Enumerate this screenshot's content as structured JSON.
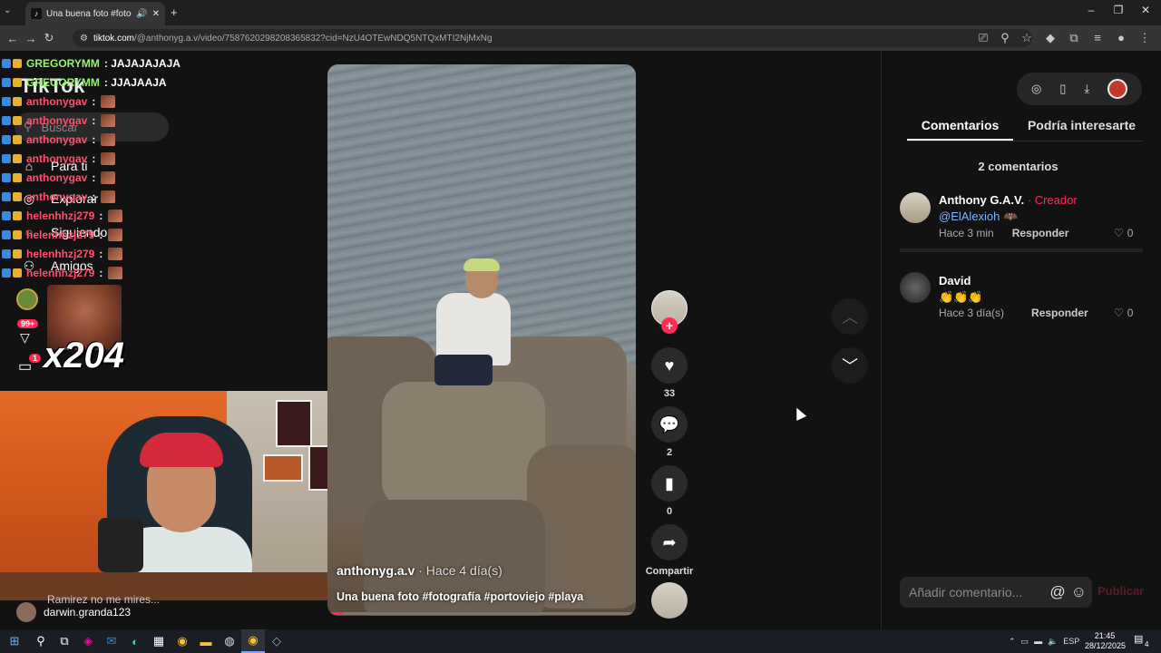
{
  "browser": {
    "tab_title": "Una buena foto #fotografía",
    "url_host": "tiktok.com",
    "url_path": "/@anthonyg.a.v/video/7587620298208365832?cid=NzU4OTEwNDQ5NTQxMTI2NjMxNg"
  },
  "sidebar": {
    "logo": "TikTok",
    "search_placeholder": "Buscar",
    "items": [
      {
        "label": "Para ti",
        "icon": "home-icon"
      },
      {
        "label": "Explorar",
        "icon": "compass-icon"
      },
      {
        "label": "Siguiendo",
        "icon": "following-icon"
      },
      {
        "label": "Amigos",
        "icon": "friends-icon"
      }
    ],
    "badge_99": "99+",
    "badge_1": "1"
  },
  "stream_chat": {
    "lines": [
      {
        "user": "GREGORYMM",
        "text": ": JAJAJAJAJA",
        "color": "#9af36e"
      },
      {
        "user": "GREGORYMM",
        "text": ": JJAJAAJA",
        "color": "#9af36e"
      },
      {
        "user": "anthonygav",
        "text": ":",
        "color": "#ff4f6d"
      },
      {
        "user": "anthonygav",
        "text": ":",
        "color": "#ff4f6d"
      },
      {
        "user": "anthonygav",
        "text": ":",
        "color": "#ff4f6d"
      },
      {
        "user": "anthonygav",
        "text": ":",
        "color": "#ff4f6d"
      },
      {
        "user": "anthonygav",
        "text": ":",
        "color": "#ff4f6d"
      },
      {
        "user": "anthonygav",
        "text": ":",
        "color": "#ff4f6d"
      },
      {
        "user": "helenhhzj279",
        "text": ":",
        "color": "#ff4f6d"
      },
      {
        "user": "helenhhzj279",
        "text": ":",
        "color": "#ff4f6d"
      },
      {
        "user": "helenhhzj279",
        "text": ":",
        "color": "#ff4f6d"
      },
      {
        "user": "helenhhzj279",
        "text": ":",
        "color": "#ff4f6d"
      }
    ],
    "multiplier": "x204",
    "bottom_message": "Ramirez no me mires...",
    "bottom_user": "darwin.granda123"
  },
  "video": {
    "author": "anthonyg.a.v",
    "ago": "· Hace 4 día(s)",
    "description": "Una buena foto #fotografía #portoviejo #playa",
    "progress": 0.05
  },
  "actions": {
    "likes": "33",
    "comments": "2",
    "saves": "0",
    "share_label": "Compartir"
  },
  "panel": {
    "tab_comments": "Comentarios",
    "tab_interest": "Podría interesarte",
    "comment_count": "2 comentarios",
    "comments": [
      {
        "name": "Anthony G.A.V.",
        "role": "· Creador",
        "body_mention": "@ElAlexioh",
        "body_extra": " 🦇",
        "time": "Hace 3 min",
        "reply": "Responder",
        "likes": "0"
      },
      {
        "name": "David",
        "role": "",
        "body_mention": "",
        "body_extra": "👏👏👏",
        "time": "Hace 3 día(s)",
        "reply": "Responder",
        "likes": "0"
      }
    ],
    "input_placeholder": "Añadir comentario...",
    "publish": "Publicar"
  },
  "taskbar": {
    "lang": "ESP",
    "time": "21:45",
    "date": "28/12/2025",
    "notifications": "4"
  },
  "colors": {
    "accent": "#fe2c55",
    "mention": "#7fb2ff"
  }
}
